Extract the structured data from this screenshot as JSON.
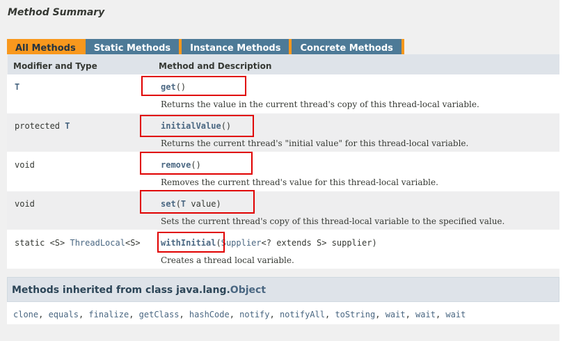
{
  "summary_title": "Method Summary",
  "tabs": [
    {
      "label": "All Methods",
      "active": true
    },
    {
      "label": "Static Methods",
      "active": false
    },
    {
      "label": "Instance Methods",
      "active": false
    },
    {
      "label": "Concrete Methods",
      "active": false
    }
  ],
  "table": {
    "headers": [
      "Modifier and Type",
      "Method and Description"
    ],
    "rows": [
      {
        "modifier_prefix": "",
        "modifier_type": "T",
        "modifier_suffix": "",
        "method_name": "get",
        "params": "()",
        "description": "Returns the value in the current thread's copy of this thread-local variable."
      },
      {
        "modifier_prefix": "protected ",
        "modifier_type": "T",
        "modifier_suffix": "",
        "method_name": "initialValue",
        "params": "()",
        "description": "Returns the current thread's \"initial value\" for this thread-local variable."
      },
      {
        "modifier_prefix": "void",
        "modifier_type": "",
        "modifier_suffix": "",
        "method_name": "remove",
        "params": "()",
        "description": "Removes the current thread's value for this thread-local variable."
      },
      {
        "modifier_prefix": "void",
        "modifier_type": "",
        "modifier_suffix": "",
        "method_name": "set",
        "params_open": "(",
        "params_type": "T",
        "params_rest": " value)",
        "description": "Sets the current thread's copy of this thread-local variable to the specified value."
      },
      {
        "modifier_prefix": "static <S> ",
        "modifier_type": "ThreadLocal",
        "modifier_suffix": "<S>",
        "method_name": "withInitial",
        "params_open": "(",
        "params_type": "Supplier",
        "params_rest": "<? extends S> supplier)",
        "description": "Creates a thread local variable."
      }
    ]
  },
  "inherited": {
    "title_prefix": "Methods inherited from class java.lang.",
    "title_class": "Object",
    "methods": [
      "clone",
      "equals",
      "finalize",
      "getClass",
      "hashCode",
      "notify",
      "notifyAll",
      "toString",
      "wait",
      "wait",
      "wait"
    ],
    "separator": ", "
  },
  "colors": {
    "tab_active": "#f8981d",
    "tab_inactive": "#4d7a97",
    "link": "#4a6782",
    "highlight_box": "#e00000",
    "header_bg": "#dee3e9",
    "alt_row": "#eeeeef"
  }
}
